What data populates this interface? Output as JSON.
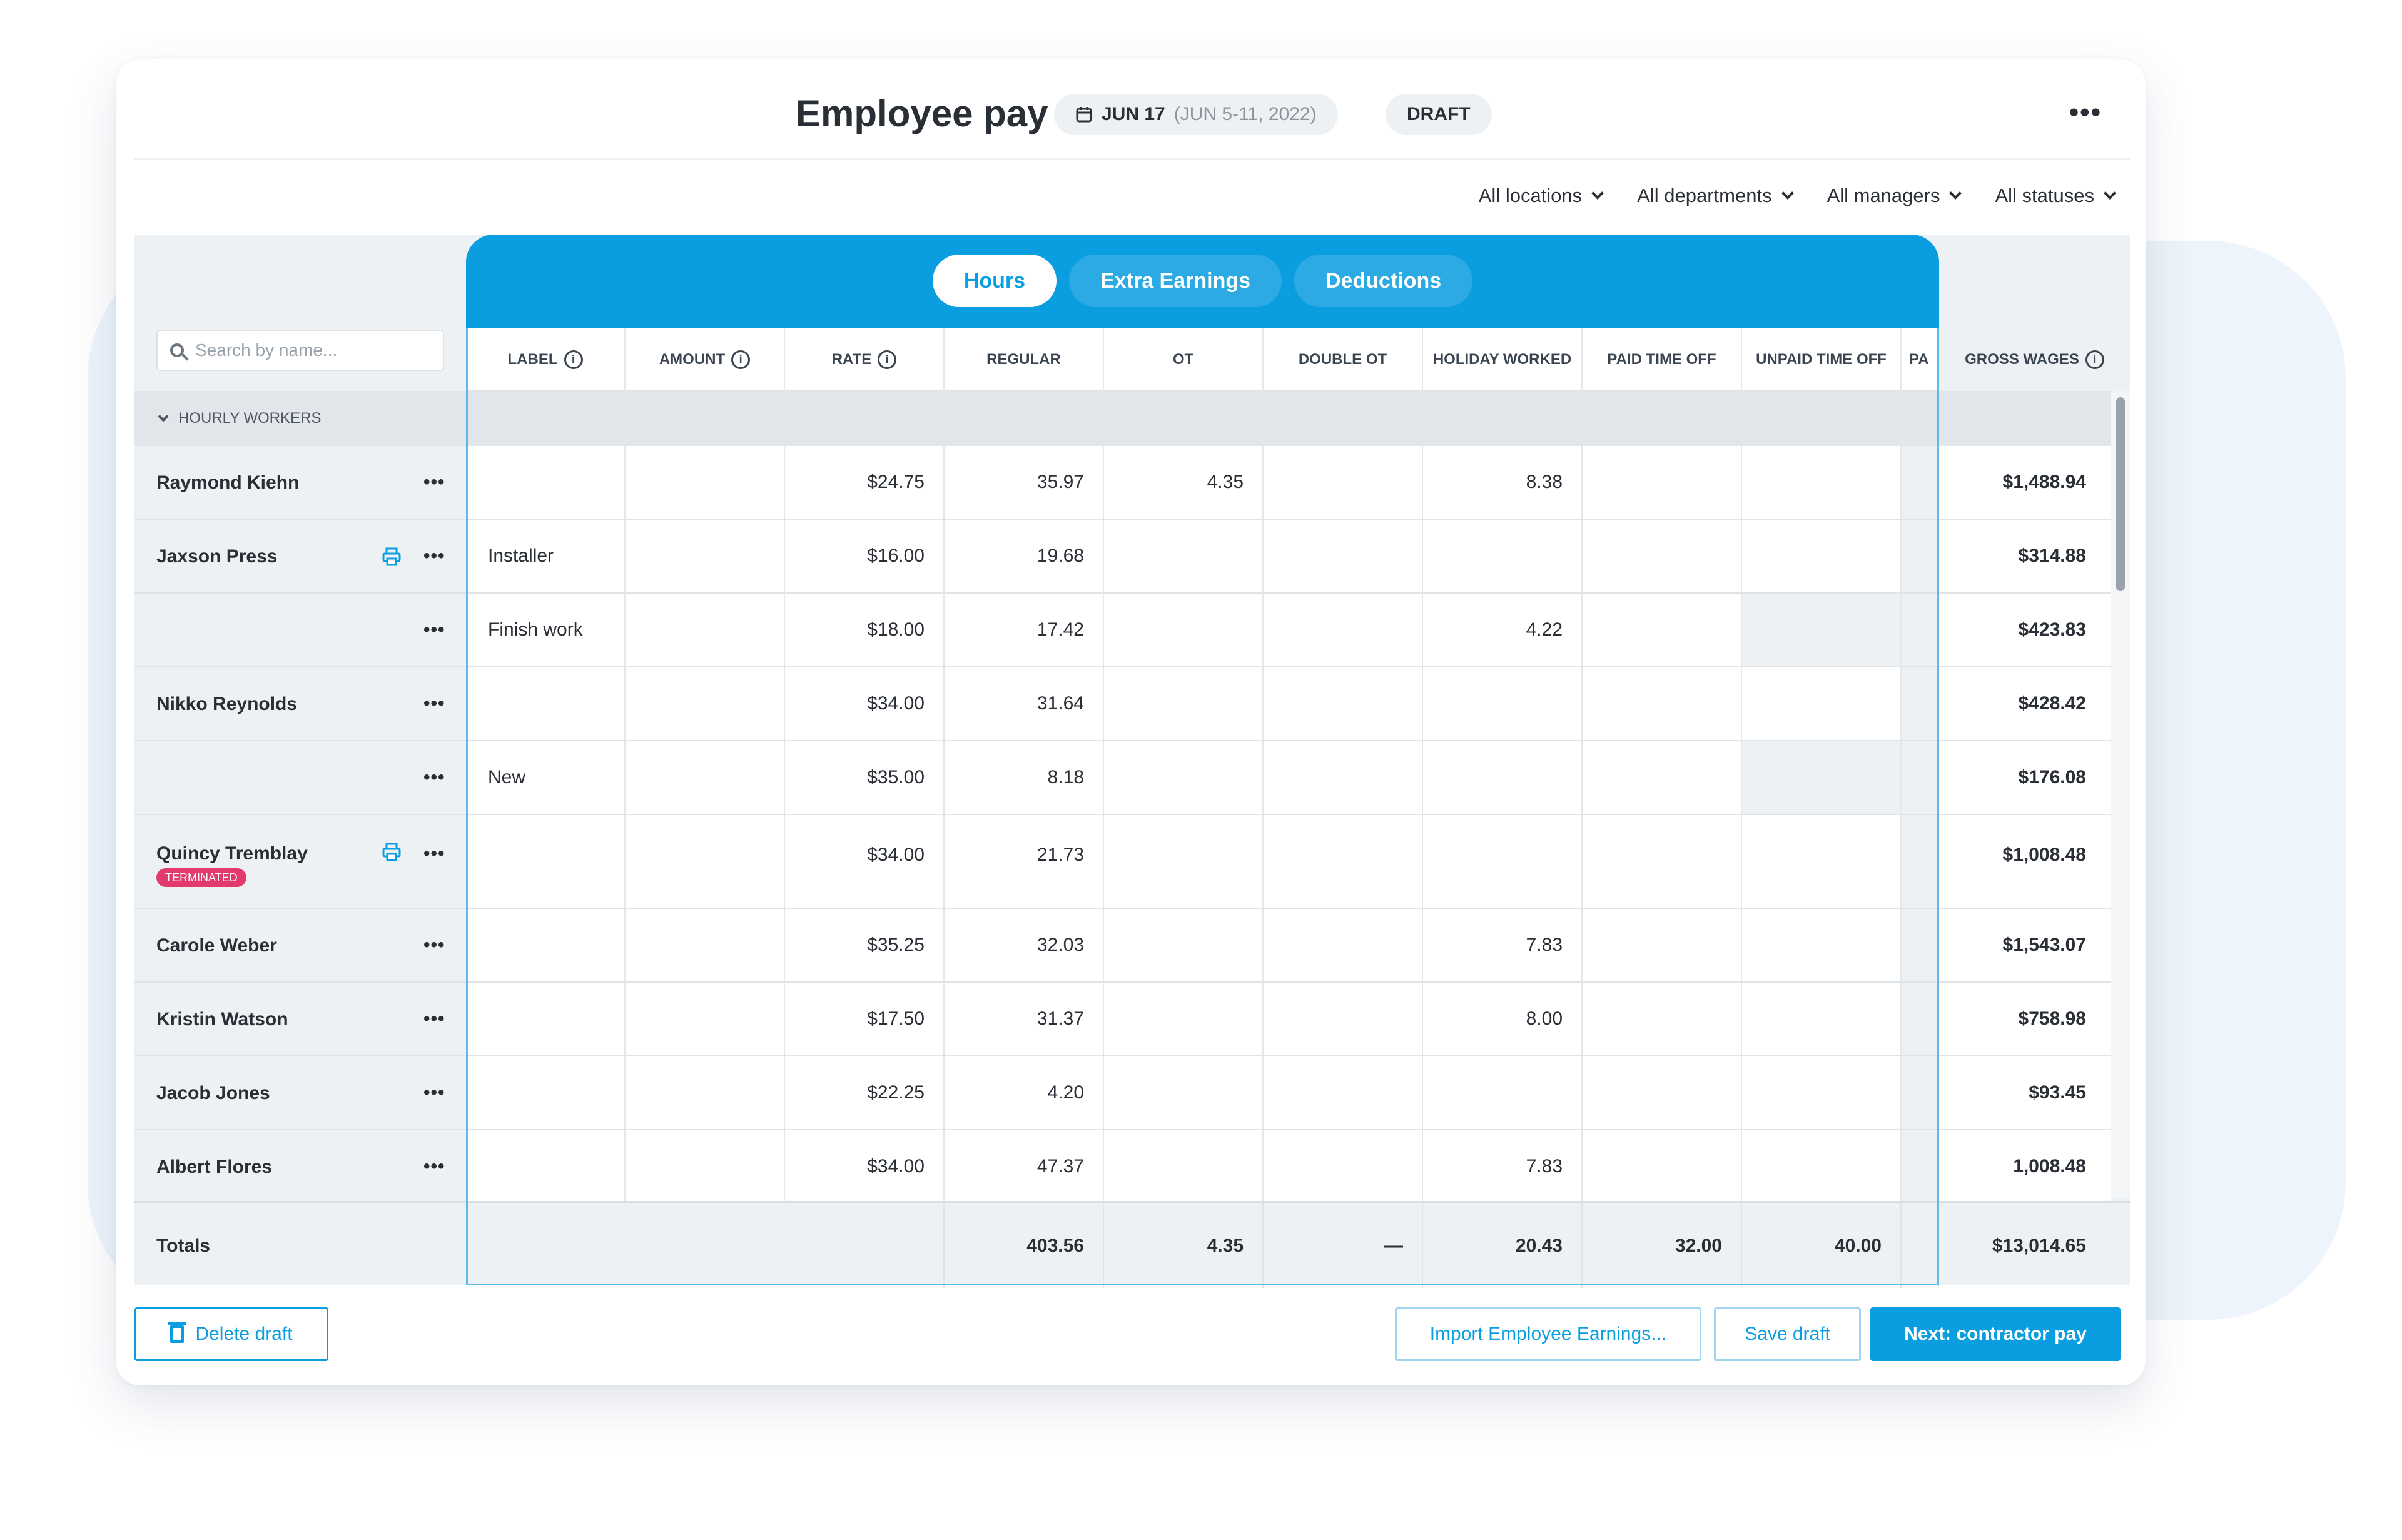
{
  "header": {
    "title": "Employee pay",
    "date_bold": "JUN 17",
    "date_range": "(JUN 5-11, 2022)",
    "status": "DRAFT"
  },
  "filters": [
    "All locations",
    "All departments",
    "All managers",
    "All statuses"
  ],
  "tabs": [
    {
      "label": "Hours",
      "active": true
    },
    {
      "label": "Extra Earnings",
      "active": false
    },
    {
      "label": "Deductions",
      "active": false
    }
  ],
  "search": {
    "placeholder": "Search by name..."
  },
  "columns": {
    "label": "LABEL",
    "amount": "AMOUNT",
    "rate": "RATE",
    "regular": "REGULAR",
    "ot": "OT",
    "double_ot": "DOUBLE OT",
    "holiday_worked": "HOLIDAY WORKED",
    "paid_time_off": "PAID TIME OFF",
    "unpaid_time_off": "UNPAID TIME OFF",
    "pa": "PA",
    "gross_wages": "GROSS WAGES"
  },
  "group": {
    "label": "HOURLY WORKERS"
  },
  "rows": [
    {
      "name": "Raymond Kiehn",
      "label": "",
      "amount": "",
      "rate": "$24.75",
      "regular": "35.97",
      "ot": "4.35",
      "double_ot": "",
      "holiday": "8.38",
      "pto": "",
      "upto": "",
      "gross": "$1,488.94"
    },
    {
      "name": "Jaxson Press",
      "label": "Installer",
      "amount": "",
      "rate": "$16.00",
      "regular": "19.68",
      "ot": "",
      "double_ot": "",
      "holiday": "",
      "pto": "",
      "upto": "",
      "gross": "$314.88"
    },
    {
      "name": "",
      "label": "Finish work",
      "amount": "",
      "rate": "$18.00",
      "regular": "17.42",
      "ot": "",
      "double_ot": "",
      "holiday": "4.22",
      "pto": "",
      "upto": "",
      "gross": "$423.83"
    },
    {
      "name": "Nikko Reynolds",
      "label": "",
      "amount": "",
      "rate": "$34.00",
      "regular": "31.64",
      "ot": "",
      "double_ot": "",
      "holiday": "",
      "pto": "",
      "upto": "",
      "gross": "$428.42"
    },
    {
      "name": "",
      "label": "New",
      "amount": "",
      "rate": "$35.00",
      "regular": "8.18",
      "ot": "",
      "double_ot": "",
      "holiday": "",
      "pto": "",
      "upto": "",
      "gross": "$176.08"
    },
    {
      "name": "Quincy Tremblay",
      "badge": "TERMINATED",
      "label": "",
      "amount": "",
      "rate": "$34.00",
      "regular": "21.73",
      "ot": "",
      "double_ot": "",
      "holiday": "",
      "pto": "",
      "upto": "",
      "gross": "$1,008.48"
    },
    {
      "name": "Carole Weber",
      "label": "",
      "amount": "",
      "rate": "$35.25",
      "regular": "32.03",
      "ot": "",
      "double_ot": "",
      "holiday": "7.83",
      "pto": "",
      "upto": "",
      "gross": "$1,543.07"
    },
    {
      "name": "Kristin Watson",
      "label": "",
      "amount": "",
      "rate": "$17.50",
      "regular": "31.37",
      "ot": "",
      "double_ot": "",
      "holiday": "8.00",
      "pto": "",
      "upto": "",
      "gross": "$758.98"
    },
    {
      "name": "Jacob Jones",
      "label": "",
      "amount": "",
      "rate": "$22.25",
      "regular": "4.20",
      "ot": "",
      "double_ot": "",
      "holiday": "",
      "pto": "",
      "upto": "",
      "gross": "$93.45"
    },
    {
      "name": "Albert Flores",
      "label": "",
      "amount": "",
      "rate": "$34.00",
      "regular": "47.37",
      "ot": "",
      "double_ot": "",
      "holiday": "7.83",
      "pto": "",
      "upto": "",
      "gross": "1,008.48"
    }
  ],
  "totals": {
    "label": "Totals",
    "regular": "403.56",
    "ot": "4.35",
    "double_ot": "—",
    "holiday": "20.43",
    "pto": "32.00",
    "upto": "40.00",
    "gross": "$13,014.65"
  },
  "footer": {
    "delete": "Delete draft",
    "import": "Import Employee Earnings...",
    "save": "Save draft",
    "next": "Next: contractor pay"
  },
  "colors": {
    "accent": "#0a9de0",
    "terminated": "#e23a6d"
  }
}
